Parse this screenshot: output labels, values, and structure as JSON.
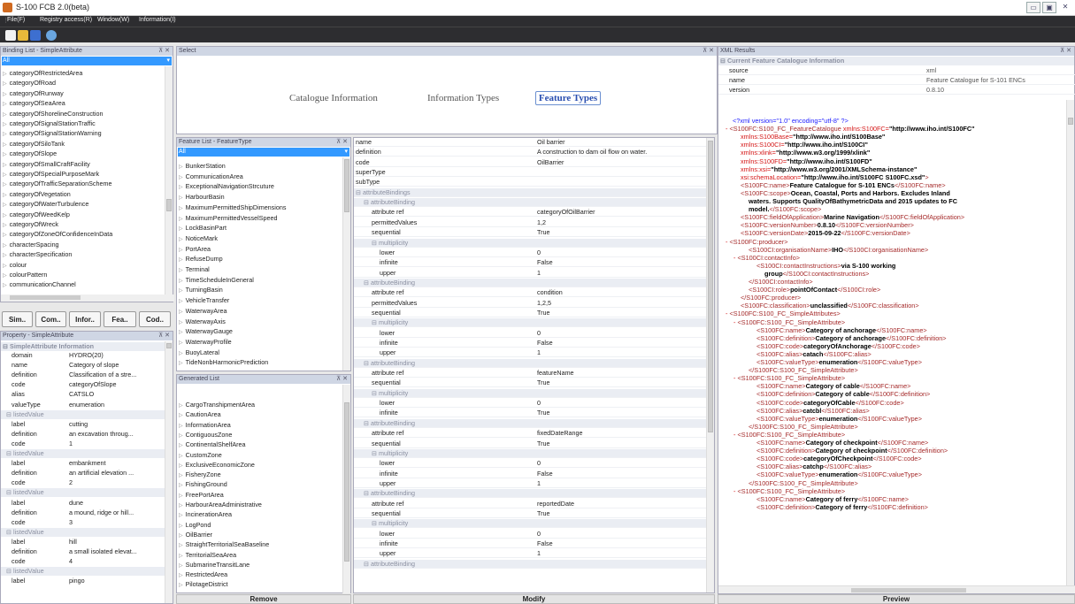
{
  "app": {
    "title": "S-100 FCB 2.0(beta)"
  },
  "menu": [
    "File(F)",
    "Registry access(R)",
    "Window(W)",
    "Information(I)"
  ],
  "binding_panel": {
    "title": "Binding List - SimpleAttribute",
    "filter": "All",
    "items": [
      "categoryOfRestrictedArea",
      "categoryOfRoad",
      "categoryOfRunway",
      "categoryOfSeaArea",
      "categoryOfShorelineConstruction",
      "categoryOfSignalStationTraffic",
      "categoryOfSignalStationWarning",
      "categoryOfSiloTank",
      "categoryOfSlope",
      "categoryOfSmallCraftFacility",
      "categoryOfSpecialPurposeMark",
      "categoryOfTrafficSeparationScheme",
      "categoryOfVegetation",
      "categoryOfWaterTurbulence",
      "categoryOfWeedKelp",
      "categoryOfWreck",
      "categoryOfZoneOfConfidenceInData",
      "characterSpacing",
      "characterSpecification",
      "colour",
      "colourPattern",
      "communicationChannel"
    ]
  },
  "tabs": [
    "Sim..",
    "Com..",
    "Infor..",
    "Fea..",
    "Cod.."
  ],
  "property_panel": {
    "title": "Property - SimpleAttribute",
    "section": "SimpleAttribute Information",
    "rows": [
      {
        "k": "domain",
        "v": "HYDRO(20)"
      },
      {
        "k": "name",
        "v": "Category of slope"
      },
      {
        "k": "definition",
        "v": "Classification of a stre..."
      },
      {
        "k": "code",
        "v": "categoryOfSlope"
      },
      {
        "k": "alias",
        "v": "CATSLO"
      },
      {
        "k": "valueType",
        "v": "enumeration"
      },
      {
        "g": "listedValue"
      },
      {
        "k": "label",
        "v": "cutting"
      },
      {
        "k": "definition",
        "v": "an excavation throug..."
      },
      {
        "k": "code",
        "v": "1"
      },
      {
        "g": "listedValue"
      },
      {
        "k": "label",
        "v": "embankment"
      },
      {
        "k": "definition",
        "v": "an artificial elevation ..."
      },
      {
        "k": "code",
        "v": "2"
      },
      {
        "g": "listedValue"
      },
      {
        "k": "label",
        "v": "dune"
      },
      {
        "k": "definition",
        "v": "a mound, ridge or hill..."
      },
      {
        "k": "code",
        "v": "3"
      },
      {
        "g": "listedValue"
      },
      {
        "k": "label",
        "v": "hill"
      },
      {
        "k": "definition",
        "v": "a small isolated elevat..."
      },
      {
        "k": "code",
        "v": "4"
      },
      {
        "g": "listedValue"
      },
      {
        "k": "label",
        "v": "pingo"
      }
    ]
  },
  "select_panel": {
    "title": "Select",
    "tabs": [
      "Catalogue Information",
      "Information Types",
      "Feature Types"
    ]
  },
  "feature_panel": {
    "title": "Feature List - FeatureType",
    "filter": "All",
    "items": [
      "BunkerStation",
      "CommunicationArea",
      "ExceptionalNavigationStrcuture",
      "HarbourBasin",
      "MaximumPermittedShipDimensions",
      "MaximumPermittedVesselSpeed",
      "LockBasinPart",
      "NoticeMark",
      "PortArea",
      "RefuseDump",
      "Terminal",
      "TimeScheduleInGeneral",
      "TurningBasin",
      "VehicleTransfer",
      "WaterwayArea",
      "WaterwayAxis",
      "WaterwayGauge",
      "WaterwayProfile",
      "BuoyLateral",
      "TideNonbHarmonicPrediction"
    ]
  },
  "generated_panel": {
    "title": "Generated List",
    "items": [
      "CargoTranshipmentArea",
      "CautionArea",
      "InformationArea",
      "ContiguousZone",
      "ContinentalShelfArea",
      "CustomZone",
      "ExclusiveEconomicZone",
      "FisheryZone",
      "FishingGround",
      "FreePortArea",
      "HarbourAreaAdministrative",
      "IncinerationArea",
      "LogPond",
      "OilBarrier",
      "StraightTerritorialSeaBaseline",
      "TerritorialSeaArea",
      "SubmarineTransitLane",
      "RestrictedArea",
      "PilotageDistrict"
    ],
    "remove": "Remove"
  },
  "detail_panel": {
    "modify": "Modify",
    "rows": [
      {
        "k": "name",
        "v": "Oil barrier"
      },
      {
        "k": "definition",
        "v": "A construction to dam oil flow on water."
      },
      {
        "k": "code",
        "v": "OilBarrier"
      },
      {
        "k": "superType",
        "v": ""
      },
      {
        "k": "subType",
        "v": ""
      },
      {
        "g": "attributeBindings",
        "i": 0
      },
      {
        "g": "attributeBinding",
        "i": 1
      },
      {
        "k": "attribute ref",
        "v": "categoryOfOilBarrier",
        "i": 2
      },
      {
        "k": "permittedValues",
        "v": "1,2",
        "i": 2
      },
      {
        "k": "sequential",
        "v": "True",
        "i": 2
      },
      {
        "g": "multiplicity",
        "i": 2
      },
      {
        "k": "lower",
        "v": "0",
        "i": 3
      },
      {
        "k": "infinite",
        "v": "False",
        "i": 3
      },
      {
        "k": "upper",
        "v": "1",
        "i": 3
      },
      {
        "g": "attributeBinding",
        "i": 1
      },
      {
        "k": "attribute ref",
        "v": "condition",
        "i": 2
      },
      {
        "k": "permittedValues",
        "v": "1,2,5",
        "i": 2
      },
      {
        "k": "sequential",
        "v": "True",
        "i": 2
      },
      {
        "g": "multiplicity",
        "i": 2
      },
      {
        "k": "lower",
        "v": "0",
        "i": 3
      },
      {
        "k": "infinite",
        "v": "False",
        "i": 3
      },
      {
        "k": "upper",
        "v": "1",
        "i": 3
      },
      {
        "g": "attributeBinding",
        "i": 1
      },
      {
        "k": "attribute ref",
        "v": "featureName",
        "i": 2
      },
      {
        "k": "sequential",
        "v": "True",
        "i": 2
      },
      {
        "g": "multiplicity",
        "i": 2
      },
      {
        "k": "lower",
        "v": "0",
        "i": 3
      },
      {
        "k": "infinite",
        "v": "True",
        "i": 3
      },
      {
        "g": "attributeBinding",
        "i": 1
      },
      {
        "k": "attribute ref",
        "v": "fixedDateRange",
        "i": 2
      },
      {
        "k": "sequential",
        "v": "True",
        "i": 2
      },
      {
        "g": "multiplicity",
        "i": 2
      },
      {
        "k": "lower",
        "v": "0",
        "i": 3
      },
      {
        "k": "infinite",
        "v": "False",
        "i": 3
      },
      {
        "k": "upper",
        "v": "1",
        "i": 3
      },
      {
        "g": "attributeBinding",
        "i": 1
      },
      {
        "k": "attribute ref",
        "v": "reportedDate",
        "i": 2
      },
      {
        "k": "sequential",
        "v": "True",
        "i": 2
      },
      {
        "g": "multiplicity",
        "i": 2
      },
      {
        "k": "lower",
        "v": "0",
        "i": 3
      },
      {
        "k": "infinite",
        "v": "False",
        "i": 3
      },
      {
        "k": "upper",
        "v": "1",
        "i": 3
      },
      {
        "g": "attributeBinding",
        "i": 1
      }
    ]
  },
  "xml_panel": {
    "title": "XML Results",
    "info_title": "Current Feature Catalogue Information",
    "info": [
      {
        "k": "source",
        "v": "xml"
      },
      {
        "k": "name",
        "v": "Feature Catalogue for S-101 ENCs"
      },
      {
        "k": "version",
        "v": "0.8.10"
      }
    ],
    "preview": "Preview",
    "lines": [
      {
        "i": 0,
        "p": [
          [
            "d",
            "<?xml version=\"1.0\" encoding=\"utf-8\" ?>"
          ]
        ]
      },
      {
        "i": 0,
        "m": "-",
        "p": [
          [
            "n",
            "<S100FC:S100_FC_FeatureCatalogue "
          ],
          [
            "r",
            "xmlns:S100FC="
          ],
          [
            "b",
            "\"http://www.iho.int/S100FC\""
          ]
        ]
      },
      {
        "i": 1,
        "p": [
          [
            "r",
            "xmlns:S100Base="
          ],
          [
            "b",
            "\"http://www.iho.int/S100Base\""
          ]
        ]
      },
      {
        "i": 1,
        "p": [
          [
            "r",
            "xmlns:S100CI="
          ],
          [
            "b",
            "\"http://www.iho.int/S100CI\""
          ]
        ]
      },
      {
        "i": 1,
        "p": [
          [
            "r",
            "xmlns:xlink="
          ],
          [
            "b",
            "\"http://www.w3.org/1999/xlink\""
          ]
        ]
      },
      {
        "i": 1,
        "p": [
          [
            "r",
            "xmlns:S100FD="
          ],
          [
            "b",
            "\"http://www.iho.int/S100FD\""
          ]
        ]
      },
      {
        "i": 1,
        "p": [
          [
            "r",
            "xmlns:xsi="
          ],
          [
            "b",
            "\"http://www.w3.org/2001/XMLSchema-instance\""
          ]
        ]
      },
      {
        "i": 1,
        "p": [
          [
            "r",
            "xsi:schemaLocation="
          ],
          [
            "b",
            "\"http://www.iho.int/S100FC S100FC.xsd\""
          ],
          [
            "n",
            ">"
          ]
        ]
      },
      {
        "i": 1,
        "p": [
          [
            "n",
            "<S100FC:name>"
          ],
          [
            "b",
            "Feature Catalogue for S-101 ENCs"
          ],
          [
            "n",
            "</S100FC:name>"
          ]
        ]
      },
      {
        "i": 1,
        "p": [
          [
            "n",
            "<S100FC:scope>"
          ],
          [
            "b",
            "Ocean, Coastal, Ports and Harbors. Excludes Inland"
          ]
        ]
      },
      {
        "i": 2,
        "p": [
          [
            "b",
            "waters. Supports QualityOfBathymetricData and 2015 updates to FC"
          ]
        ]
      },
      {
        "i": 2,
        "p": [
          [
            "b",
            "model."
          ],
          [
            "n",
            "</S100FC:scope>"
          ]
        ]
      },
      {
        "i": 1,
        "p": [
          [
            "n",
            "<S100FC:fieldOfApplication>"
          ],
          [
            "b",
            "Marine Navigation"
          ],
          [
            "n",
            "</S100FC:fieldOfApplication>"
          ]
        ]
      },
      {
        "i": 1,
        "p": [
          [
            "n",
            "<S100FC:versionNumber>"
          ],
          [
            "b",
            "0.8.10"
          ],
          [
            "n",
            "</S100FC:versionNumber>"
          ]
        ]
      },
      {
        "i": 1,
        "p": [
          [
            "n",
            "<S100FC:versionDate>"
          ],
          [
            "b",
            "2015-09-22"
          ],
          [
            "n",
            "</S100FC:versionDate>"
          ]
        ]
      },
      {
        "i": 0,
        "m": "-",
        "p": [
          [
            "n",
            "<S100FC:producer>"
          ]
        ]
      },
      {
        "i": 2,
        "p": [
          [
            "n",
            "<S100CI:organisationName>"
          ],
          [
            "b",
            "IHO"
          ],
          [
            "n",
            "</S100CI:organisationName>"
          ]
        ]
      },
      {
        "i": 1,
        "m": "-",
        "p": [
          [
            "n",
            "<S100CI:contactInfo>"
          ]
        ]
      },
      {
        "i": 3,
        "p": [
          [
            "n",
            "<S100CI:contactInstructions>"
          ],
          [
            "b",
            "via S-100 working"
          ]
        ]
      },
      {
        "i": 4,
        "p": [
          [
            "b",
            "group"
          ],
          [
            "n",
            "</S100CI:contactInstructions>"
          ]
        ]
      },
      {
        "i": 2,
        "p": [
          [
            "n",
            "</S100CI:contactInfo>"
          ]
        ]
      },
      {
        "i": 2,
        "p": [
          [
            "n",
            "<S100CI:role>"
          ],
          [
            "b",
            "pointOfContact"
          ],
          [
            "n",
            "</S100CI:role>"
          ]
        ]
      },
      {
        "i": 1,
        "p": [
          [
            "n",
            "</S100FC:producer>"
          ]
        ]
      },
      {
        "i": 1,
        "p": [
          [
            "n",
            "<S100FC:classification>"
          ],
          [
            "b",
            "unclassified"
          ],
          [
            "n",
            "</S100FC:classification>"
          ]
        ]
      },
      {
        "i": 0,
        "m": "-",
        "p": [
          [
            "n",
            "<S100FC:S100_FC_SimpleAttributes>"
          ]
        ]
      },
      {
        "i": 1,
        "m": "-",
        "p": [
          [
            "n",
            "<S100FC:S100_FC_SimpleAttribute>"
          ]
        ]
      },
      {
        "i": 3,
        "p": [
          [
            "n",
            "<S100FC:name>"
          ],
          [
            "b",
            "Category of anchorage"
          ],
          [
            "n",
            "</S100FC:name>"
          ]
        ]
      },
      {
        "i": 3,
        "p": [
          [
            "n",
            "<S100FC:definition>"
          ],
          [
            "b",
            "Category of anchorage"
          ],
          [
            "n",
            "</S100FC:definition>"
          ]
        ]
      },
      {
        "i": 3,
        "p": [
          [
            "n",
            "<S100FC:code>"
          ],
          [
            "b",
            "categoryOfAnchorage"
          ],
          [
            "n",
            "</S100FC:code>"
          ]
        ]
      },
      {
        "i": 3,
        "p": [
          [
            "n",
            "<S100FC:alias>"
          ],
          [
            "b",
            "catach"
          ],
          [
            "n",
            "</S100FC:alias>"
          ]
        ]
      },
      {
        "i": 3,
        "p": [
          [
            "n",
            "<S100FC:valueType>"
          ],
          [
            "b",
            "enumeration"
          ],
          [
            "n",
            "</S100FC:valueType>"
          ]
        ]
      },
      {
        "i": 2,
        "p": [
          [
            "n",
            "</S100FC:S100_FC_SimpleAttribute>"
          ]
        ]
      },
      {
        "i": 1,
        "m": "-",
        "p": [
          [
            "n",
            "<S100FC:S100_FC_SimpleAttribute>"
          ]
        ]
      },
      {
        "i": 3,
        "p": [
          [
            "n",
            "<S100FC:name>"
          ],
          [
            "b",
            "Category of cable"
          ],
          [
            "n",
            "</S100FC:name>"
          ]
        ]
      },
      {
        "i": 3,
        "p": [
          [
            "n",
            "<S100FC:definition>"
          ],
          [
            "b",
            "Category of cable"
          ],
          [
            "n",
            "</S100FC:definition>"
          ]
        ]
      },
      {
        "i": 3,
        "p": [
          [
            "n",
            "<S100FC:code>"
          ],
          [
            "b",
            "categoryOfCable"
          ],
          [
            "n",
            "</S100FC:code>"
          ]
        ]
      },
      {
        "i": 3,
        "p": [
          [
            "n",
            "<S100FC:alias>"
          ],
          [
            "b",
            "catcbl"
          ],
          [
            "n",
            "</S100FC:alias>"
          ]
        ]
      },
      {
        "i": 3,
        "p": [
          [
            "n",
            "<S100FC:valueType>"
          ],
          [
            "b",
            "enumeration"
          ],
          [
            "n",
            "</S100FC:valueType>"
          ]
        ]
      },
      {
        "i": 2,
        "p": [
          [
            "n",
            "</S100FC:S100_FC_SimpleAttribute>"
          ]
        ]
      },
      {
        "i": 1,
        "m": "-",
        "p": [
          [
            "n",
            "<S100FC:S100_FC_SimpleAttribute>"
          ]
        ]
      },
      {
        "i": 3,
        "p": [
          [
            "n",
            "<S100FC:name>"
          ],
          [
            "b",
            "Category of checkpoint"
          ],
          [
            "n",
            "</S100FC:name>"
          ]
        ]
      },
      {
        "i": 3,
        "p": [
          [
            "n",
            "<S100FC:definition>"
          ],
          [
            "b",
            "Category of checkpoint"
          ],
          [
            "n",
            "</S100FC:definition>"
          ]
        ]
      },
      {
        "i": 3,
        "p": [
          [
            "n",
            "<S100FC:code>"
          ],
          [
            "b",
            "categoryOfCheckpoint"
          ],
          [
            "n",
            "</S100FC:code>"
          ]
        ]
      },
      {
        "i": 3,
        "p": [
          [
            "n",
            "<S100FC:alias>"
          ],
          [
            "b",
            "catchp"
          ],
          [
            "n",
            "</S100FC:alias>"
          ]
        ]
      },
      {
        "i": 3,
        "p": [
          [
            "n",
            "<S100FC:valueType>"
          ],
          [
            "b",
            "enumeration"
          ],
          [
            "n",
            "</S100FC:valueType>"
          ]
        ]
      },
      {
        "i": 2,
        "p": [
          [
            "n",
            "</S100FC:S100_FC_SimpleAttribute>"
          ]
        ]
      },
      {
        "i": 1,
        "m": "-",
        "p": [
          [
            "n",
            "<S100FC:S100_FC_SimpleAttribute>"
          ]
        ]
      },
      {
        "i": 3,
        "p": [
          [
            "n",
            "<S100FC:name>"
          ],
          [
            "b",
            "Category of ferry"
          ],
          [
            "n",
            "</S100FC:name>"
          ]
        ]
      },
      {
        "i": 3,
        "p": [
          [
            "n",
            "<S100FC:definition>"
          ],
          [
            "b",
            "Category of ferry"
          ],
          [
            "n",
            "</S100FC:definition>"
          ]
        ]
      }
    ]
  }
}
